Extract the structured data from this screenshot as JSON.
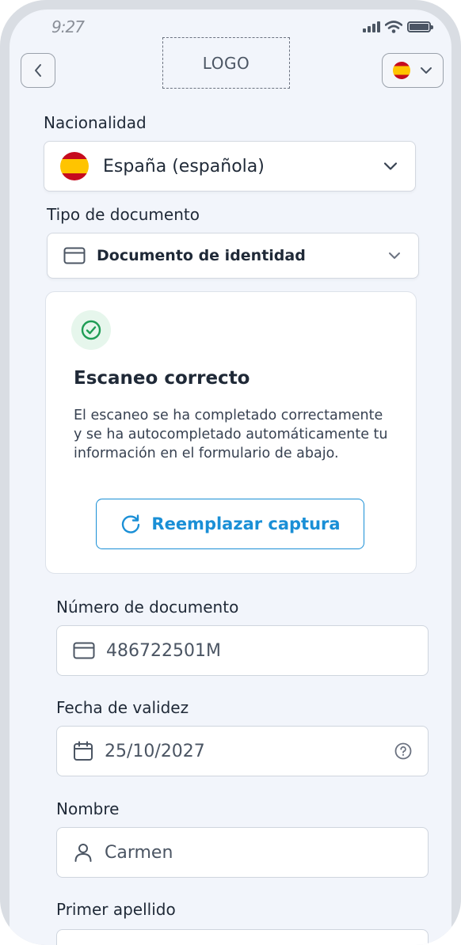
{
  "status_bar": {
    "time": "9:27"
  },
  "header": {
    "logo_text": "LOGO",
    "language_flag": "spain-flag"
  },
  "nationality": {
    "label": "Nacionalidad",
    "value": "España (española)",
    "flag": "spain-flag"
  },
  "document_type": {
    "label": "Tipo de documento",
    "value": "Documento de identidad",
    "icon": "id-card-icon"
  },
  "scan_card": {
    "title": "Escaneo correcto",
    "description": "El escaneo se ha completado correctamente y se ha autocompletado automáticamente tu información en el formulario de abajo.",
    "button_label": "Reemplazar captura",
    "status_icon": "check-circle-icon",
    "accent_color": "#1a8fd6",
    "success_color": "#1f9d55"
  },
  "fields": {
    "document_number": {
      "label": "Número de documento",
      "value": "486722501M",
      "icon": "id-card-icon"
    },
    "expiry_date": {
      "label": "Fecha de validez",
      "value": "25/10/2027",
      "icon": "calendar-icon",
      "help_icon": "question-circle-icon"
    },
    "first_name": {
      "label": "Nombre",
      "value": "Carmen",
      "icon": "user-icon"
    },
    "first_surname": {
      "label": "Primer apellido"
    }
  }
}
